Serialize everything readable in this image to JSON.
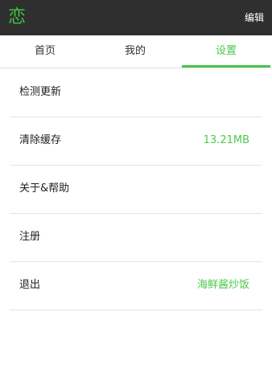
{
  "header": {
    "title": "恋",
    "edit_label": "编辑"
  },
  "tabs": [
    {
      "label": "首页"
    },
    {
      "label": "我的"
    },
    {
      "label": "设置"
    }
  ],
  "active_tab": "设置",
  "settings": {
    "items": [
      {
        "label": "检测更新",
        "value": ""
      },
      {
        "label": "清除缓存",
        "value": "13.21MB"
      },
      {
        "label": "关于&帮助",
        "value": ""
      },
      {
        "label": "注册",
        "value": ""
      },
      {
        "label": "退出",
        "value": "海鲜酱炒饭"
      }
    ]
  },
  "colors": {
    "accent": "#4cc94c",
    "topbar": "#2f2f2f"
  }
}
